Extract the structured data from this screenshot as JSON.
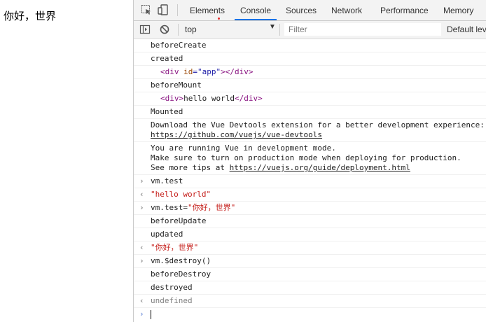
{
  "page": {
    "body_text": "你好，世界"
  },
  "devtools": {
    "tabs": [
      {
        "label": "Elements",
        "active": false
      },
      {
        "label": "Console",
        "active": true
      },
      {
        "label": "Sources",
        "active": false
      },
      {
        "label": "Network",
        "active": false
      },
      {
        "label": "Performance",
        "active": false
      },
      {
        "label": "Memory",
        "active": false
      }
    ],
    "toolbar": {
      "context": "top",
      "filter_placeholder": "Filter",
      "levels": "Default levels"
    },
    "console": {
      "l1": "beforeCreate",
      "l2": "created",
      "l3a": "<div",
      "l3b": " id",
      "l3c": "=\"app\"",
      "l3d": "></div>",
      "l4": "beforeMount",
      "l5a": "<div>",
      "l5b": "hello world",
      "l5c": "</div>",
      "l6": "Mounted",
      "l7a": "Download the Vue Devtools extension for a better development experience:",
      "l7b": "https://github.com/vuejs/vue-devtools",
      "l8a": "You are running Vue in development mode.",
      "l8b": "Make sure to turn on production mode when deploying for production.",
      "l8c": "See more tips at ",
      "l8d": "https://vuejs.org/guide/deployment.html",
      "l9": "vm.test",
      "l10": "\"hello world\"",
      "l11a": "vm.test=",
      "l11b": "\"你好，世界\"",
      "l12": "beforeUpdate",
      "l13": "updated",
      "l14": "\"你好，世界\"",
      "l15": "vm.$destroy()",
      "l16": "beforeDestroy",
      "l17": "destroyed",
      "l18": "undefined"
    },
    "colors": {
      "active_tab_underline": "#1a73e8",
      "string": "#c41a16",
      "tag": "#881280",
      "prompt": "#5b7fd4"
    },
    "icons": [
      "inspect-icon",
      "device-toggle-icon",
      "sidebar-toggle-icon",
      "clear-console-icon",
      "chevron-down-icon"
    ]
  }
}
